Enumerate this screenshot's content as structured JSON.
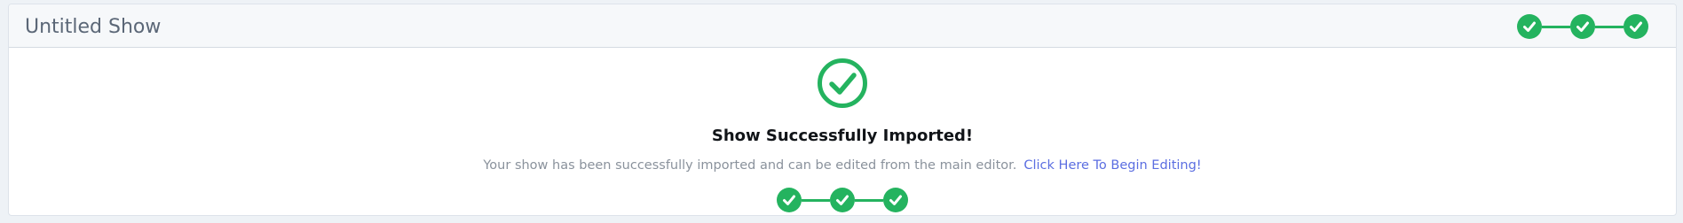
{
  "header": {
    "title": "Untitled Show",
    "progress": {
      "completed_steps": 3,
      "total_steps": 3
    }
  },
  "main": {
    "status_icon": "check-circle-icon",
    "heading": "Show Successfully Imported!",
    "message": "Your show has been successfully imported and can be edited from the main editor.",
    "link_label": "Click Here To Begin Editing!",
    "progress": {
      "completed_steps": 3,
      "total_steps": 3
    }
  },
  "colors": {
    "success": "#24b35f",
    "link": "#5b6ee1",
    "header_background": "#f6f8fa",
    "page_background": "#eef2f6"
  }
}
